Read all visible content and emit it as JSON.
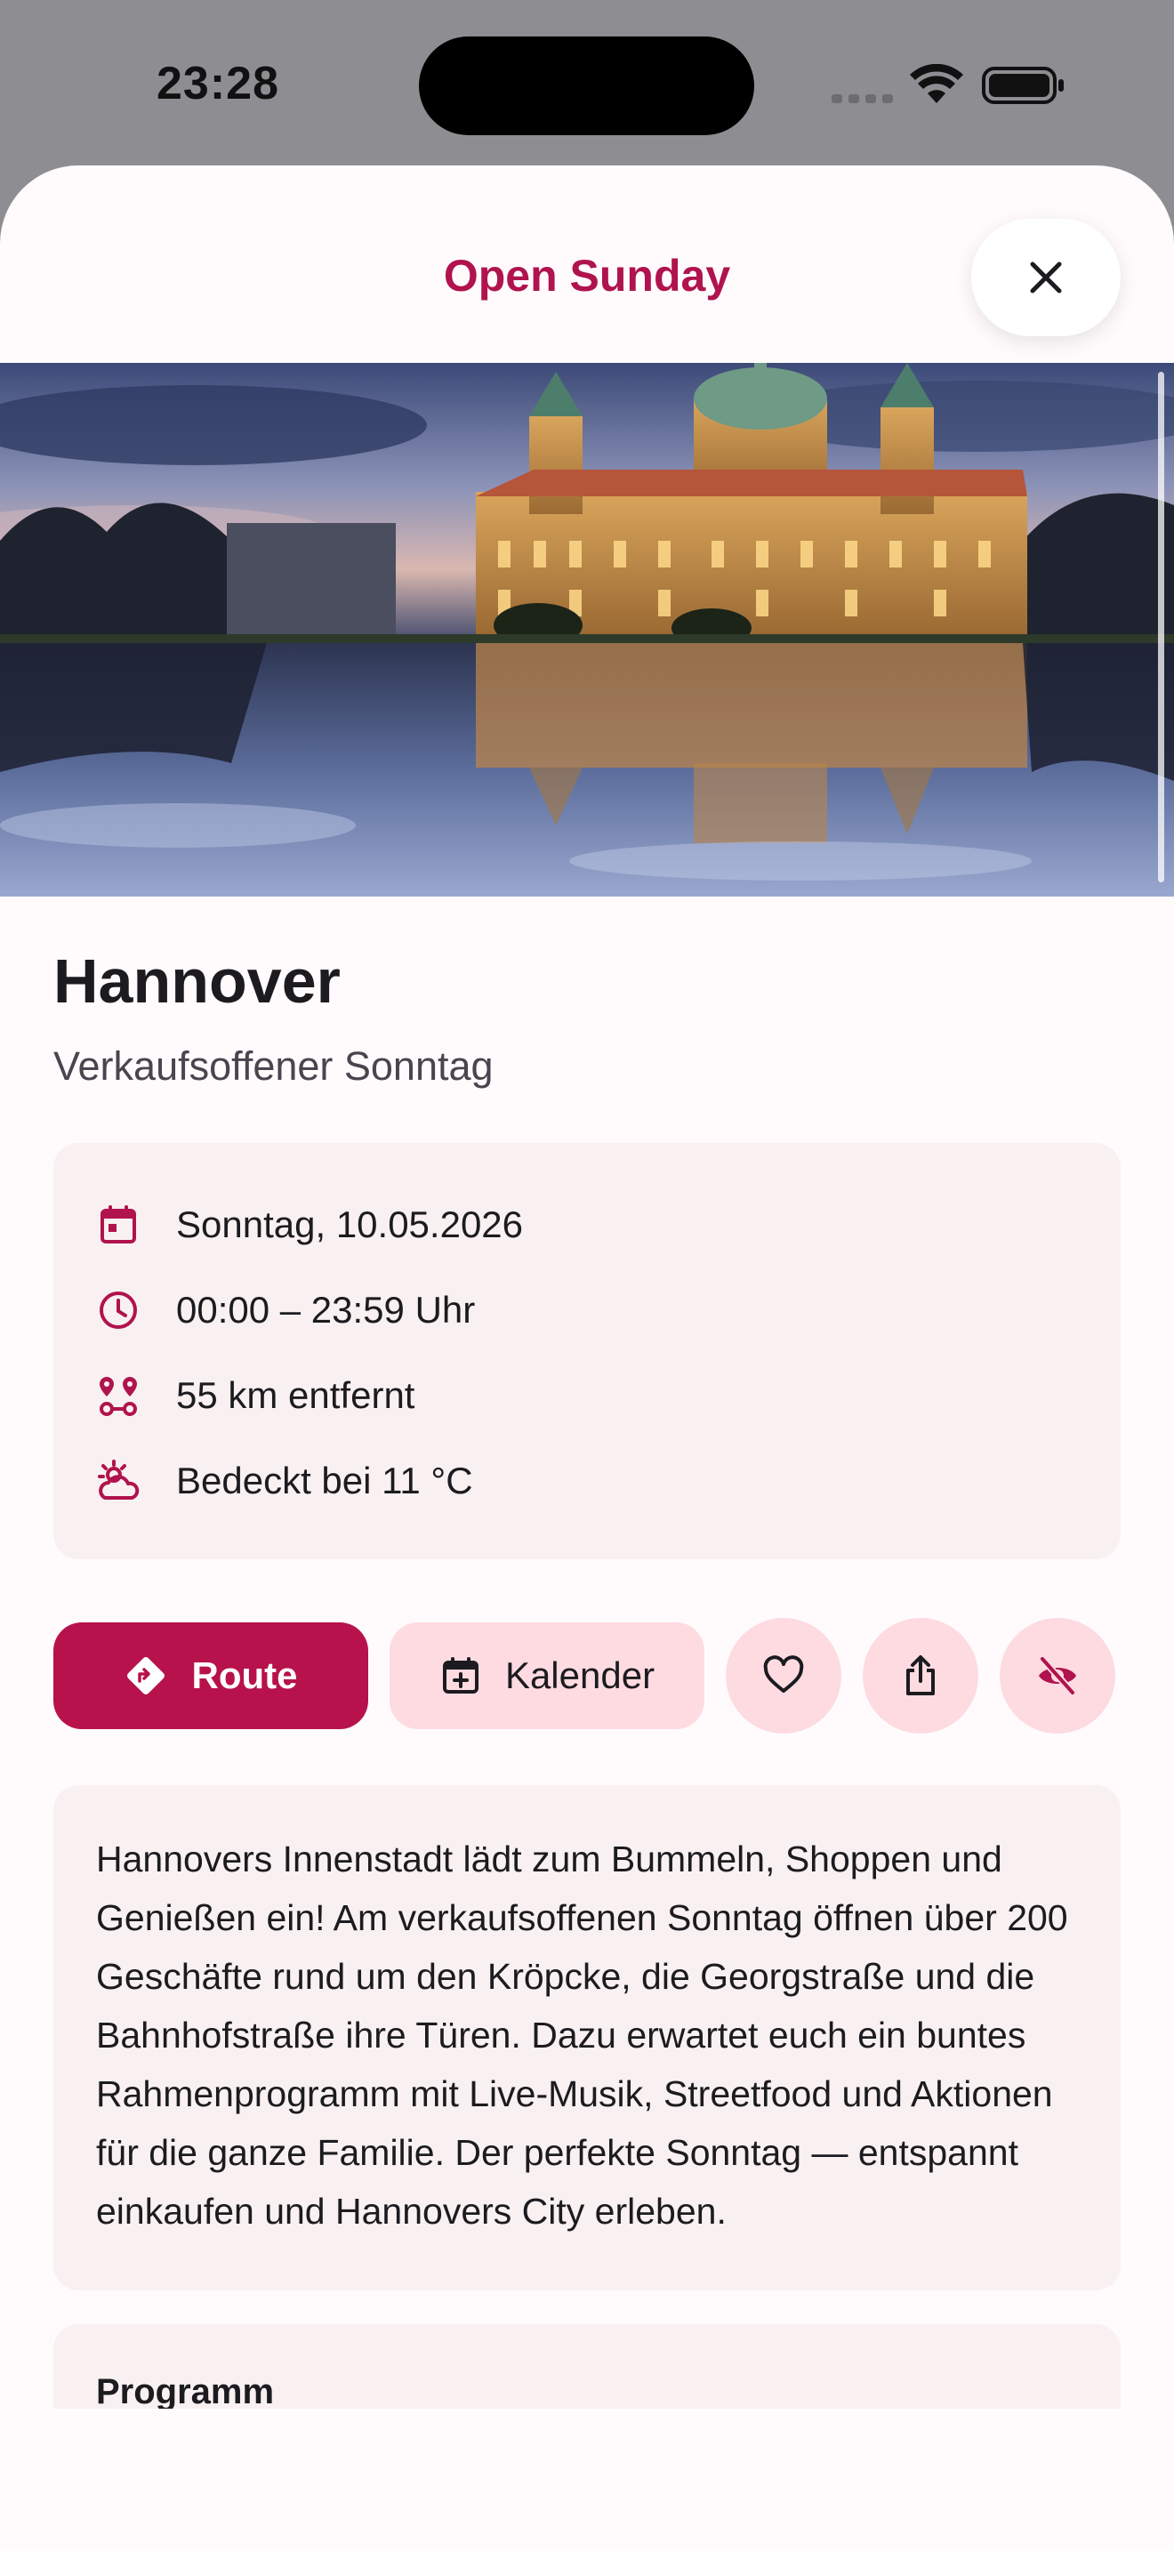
{
  "status_bar": {
    "time": "23:28"
  },
  "sheet": {
    "title": "Open Sunday",
    "close_icon": "close-icon"
  },
  "hero": {
    "alt": "Neues Rathaus Hannover at dusk reflected in the lake"
  },
  "event": {
    "title": "Hannover",
    "subtitle": "Verkaufsoffener Sonntag",
    "date": "Sonntag, 10.05.2026",
    "time": "00:00 – 23:59 Uhr",
    "distance": "55 km entfernt",
    "weather": "Bedeckt bei 11 °C"
  },
  "actions": {
    "route_label": "Route",
    "calendar_label": "Kalender",
    "favorite_icon": "heart-icon",
    "share_icon": "share-icon",
    "hide_icon": "eye-off-icon"
  },
  "description": "Hannovers Innenstadt lädt zum Bummeln, Shoppen und Genießen ein! Am verkaufsoffenen Sonntag öffnen über 200 Geschäfte rund um den Kröpcke, die Georgstraße und die Bahnhofstraße ihre Türen. Dazu erwartet euch ein buntes Rahmenprogramm mit Live-Musik, Streetfood und Aktionen für die ganze Familie. Der perfekte Sonntag — entspannt einkaufen und Hannovers City erleben.",
  "programm": {
    "title": "Programm"
  },
  "colors": {
    "accent": "#b0134d",
    "primary_button": "#b7124b",
    "tonal_button": "#fddbe1",
    "card_background": "#f9f1f1"
  }
}
